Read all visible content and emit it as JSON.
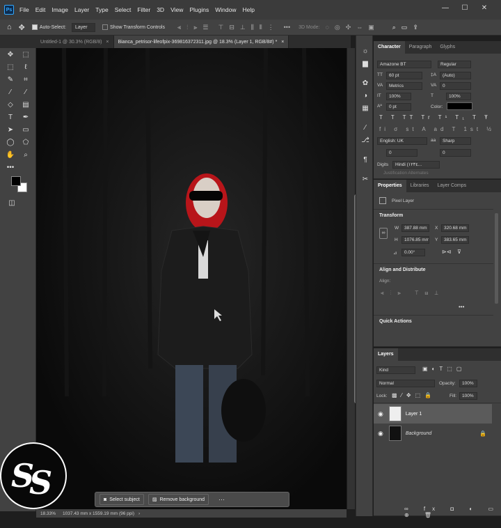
{
  "menu": {
    "items": [
      "File",
      "Edit",
      "Image",
      "Layer",
      "Type",
      "Select",
      "Filter",
      "3D",
      "View",
      "Plugins",
      "Window",
      "Help"
    ],
    "logo": "Ps"
  },
  "window_controls": {
    "minimize": "—",
    "maximize": "☐",
    "close": "✕"
  },
  "options": {
    "auto_select_label": "Auto-Select:",
    "layer_value": "Layer",
    "show_transform_label": "Show Transform Controls",
    "mode_3d": "3D Mode:"
  },
  "tabs": [
    {
      "label": "Untitled-1 @ 30.3% (RGB/8)"
    },
    {
      "label": "Bianca_petrisor-lifeofpix-369816372311.jpg @ 18.3% (Layer 1, RGB/8#) *"
    }
  ],
  "status": {
    "zoom": "18.33%",
    "doc_info": "1037.43 mm x 1559.19 mm (96 ppi)"
  },
  "context_bar": {
    "select_subject": "Select subject",
    "remove_background": "Remove background"
  },
  "character": {
    "tabs": [
      "Character",
      "Paragraph",
      "Glyphs"
    ],
    "font": "Amazone BT",
    "style": "Regular",
    "size": "60 pt",
    "leading": "(Auto)",
    "kerning": "Metrics",
    "tracking": "0",
    "vscale": "100%",
    "hscale": "100%",
    "baseline": "0 pt",
    "color_label": "Color:",
    "language": "English: UK",
    "antialias": "Sharp",
    "indent_a": "0",
    "indent_b": "0",
    "digits_label": "Digits",
    "digits_value": "Hindi (١٢٣٤...",
    "justification": "Justification Alternates"
  },
  "properties": {
    "tabs": [
      "Properties",
      "Libraries",
      "Layer Comps"
    ],
    "layer_type": "Pixel Layer",
    "transform_title": "Transform",
    "w_label": "W",
    "w": "387.88 mm",
    "x_label": "X",
    "x": "320.68 mm",
    "h_label": "H",
    "h": "1076.85 mm",
    "y_label": "Y",
    "y": "383.65 mm",
    "angle": "0.00°",
    "align_title": "Align and Distribute",
    "align_label": "Align:",
    "quick_actions": "Quick Actions"
  },
  "layers": {
    "title": "Layers",
    "kind": "Kind",
    "blend": "Normal",
    "opacity_label": "Opacity:",
    "opacity": "100%",
    "lock_label": "Lock:",
    "fill_label": "Fill:",
    "fill": "100%",
    "rows": [
      {
        "name": "Layer 1"
      },
      {
        "name": "Background"
      }
    ]
  },
  "colors": {
    "accent": "#31a8ff",
    "hood": "#b8151a"
  }
}
